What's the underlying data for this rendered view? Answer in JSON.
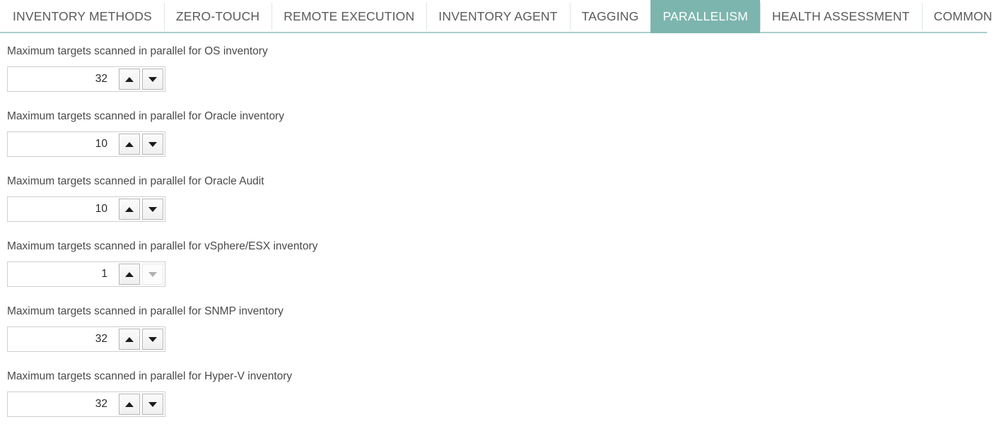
{
  "tabs": [
    {
      "label": "INVENTORY METHODS",
      "active": false
    },
    {
      "label": "ZERO-TOUCH",
      "active": false
    },
    {
      "label": "REMOTE EXECUTION",
      "active": false
    },
    {
      "label": "INVENTORY AGENT",
      "active": false
    },
    {
      "label": "TAGGING",
      "active": false
    },
    {
      "label": "PARALLELISM",
      "active": true
    },
    {
      "label": "HEALTH ASSESSMENT",
      "active": false
    },
    {
      "label": "COMMON",
      "active": false
    }
  ],
  "colors": {
    "active_tab_background": "#7cb5ae",
    "active_tab_text": "#ffffff",
    "tab_text": "#5a5a5a",
    "tab_rule": "#a8cfca",
    "label_text": "#4a4a4a",
    "input_border": "#cfcfcf",
    "button_border": "#b6b6b6",
    "disabled_arrow": "#b0b0b0"
  },
  "fields": [
    {
      "label": "Maximum targets scanned in parallel for OS inventory",
      "value": "32",
      "up_enabled": true,
      "down_enabled": true
    },
    {
      "label": "Maximum targets scanned in parallel for Oracle inventory",
      "value": "10",
      "up_enabled": true,
      "down_enabled": true
    },
    {
      "label": "Maximum targets scanned in parallel for Oracle Audit",
      "value": "10",
      "up_enabled": true,
      "down_enabled": true
    },
    {
      "label": "Maximum targets scanned in parallel for vSphere/ESX inventory",
      "value": "1",
      "up_enabled": true,
      "down_enabled": false
    },
    {
      "label": "Maximum targets scanned in parallel for SNMP inventory",
      "value": "32",
      "up_enabled": true,
      "down_enabled": true
    },
    {
      "label": "Maximum targets scanned in parallel for Hyper-V inventory",
      "value": "32",
      "up_enabled": true,
      "down_enabled": true
    }
  ]
}
